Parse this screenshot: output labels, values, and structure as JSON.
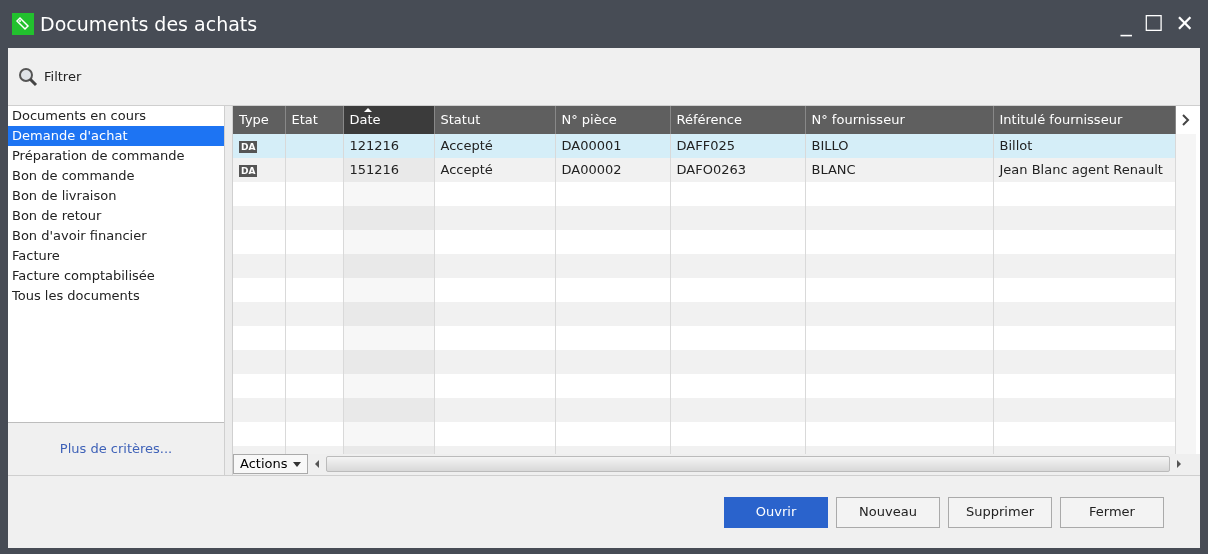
{
  "window": {
    "title": "Documents des achats",
    "controls": [
      "_",
      "☐",
      "✕"
    ]
  },
  "toolbar": {
    "filter_label": "Filtrer"
  },
  "sidebar": {
    "items": [
      {
        "label": "Documents en cours",
        "selected": false
      },
      {
        "label": "Demande d'achat",
        "selected": true
      },
      {
        "label": "Préparation de commande",
        "selected": false
      },
      {
        "label": "Bon de commande",
        "selected": false
      },
      {
        "label": "Bon de livraison",
        "selected": false
      },
      {
        "label": "Bon de retour",
        "selected": false
      },
      {
        "label": "Bon d'avoir financier",
        "selected": false
      },
      {
        "label": "Facture",
        "selected": false
      },
      {
        "label": "Facture comptabilisée",
        "selected": false
      },
      {
        "label": "Tous les documents",
        "selected": false
      }
    ],
    "more_link": "Plus de critères..."
  },
  "table": {
    "columns": [
      {
        "label": "Type",
        "sorted": false,
        "kind": "badge"
      },
      {
        "label": "Etat",
        "sorted": false
      },
      {
        "label": "Date",
        "sorted": true
      },
      {
        "label": "Statut",
        "sorted": false
      },
      {
        "label": "N° pièce",
        "sorted": false
      },
      {
        "label": "Référence",
        "sorted": false
      },
      {
        "label": "N° fournisseur",
        "sorted": false
      },
      {
        "label": "Intitulé fournisseur",
        "sorted": false
      }
    ],
    "rows": [
      {
        "selected": true,
        "cells": [
          "DA",
          "",
          "121216",
          "Accepté",
          "DA00001",
          "DAFF025",
          "BILLO",
          "Billot"
        ]
      },
      {
        "selected": false,
        "cells": [
          "DA",
          "",
          "151216",
          "Accepté",
          "DA00002",
          "DAFO0263",
          "BLANC",
          "Jean Blanc agent Renault"
        ]
      }
    ],
    "actions_label": "Actions"
  },
  "buttons": [
    {
      "label": "Ouvrir",
      "kind": "primary"
    },
    {
      "label": "Nouveau",
      "kind": "default"
    },
    {
      "label": "Supprimer",
      "kind": "default"
    },
    {
      "label": "Fermer",
      "kind": "default"
    }
  ]
}
